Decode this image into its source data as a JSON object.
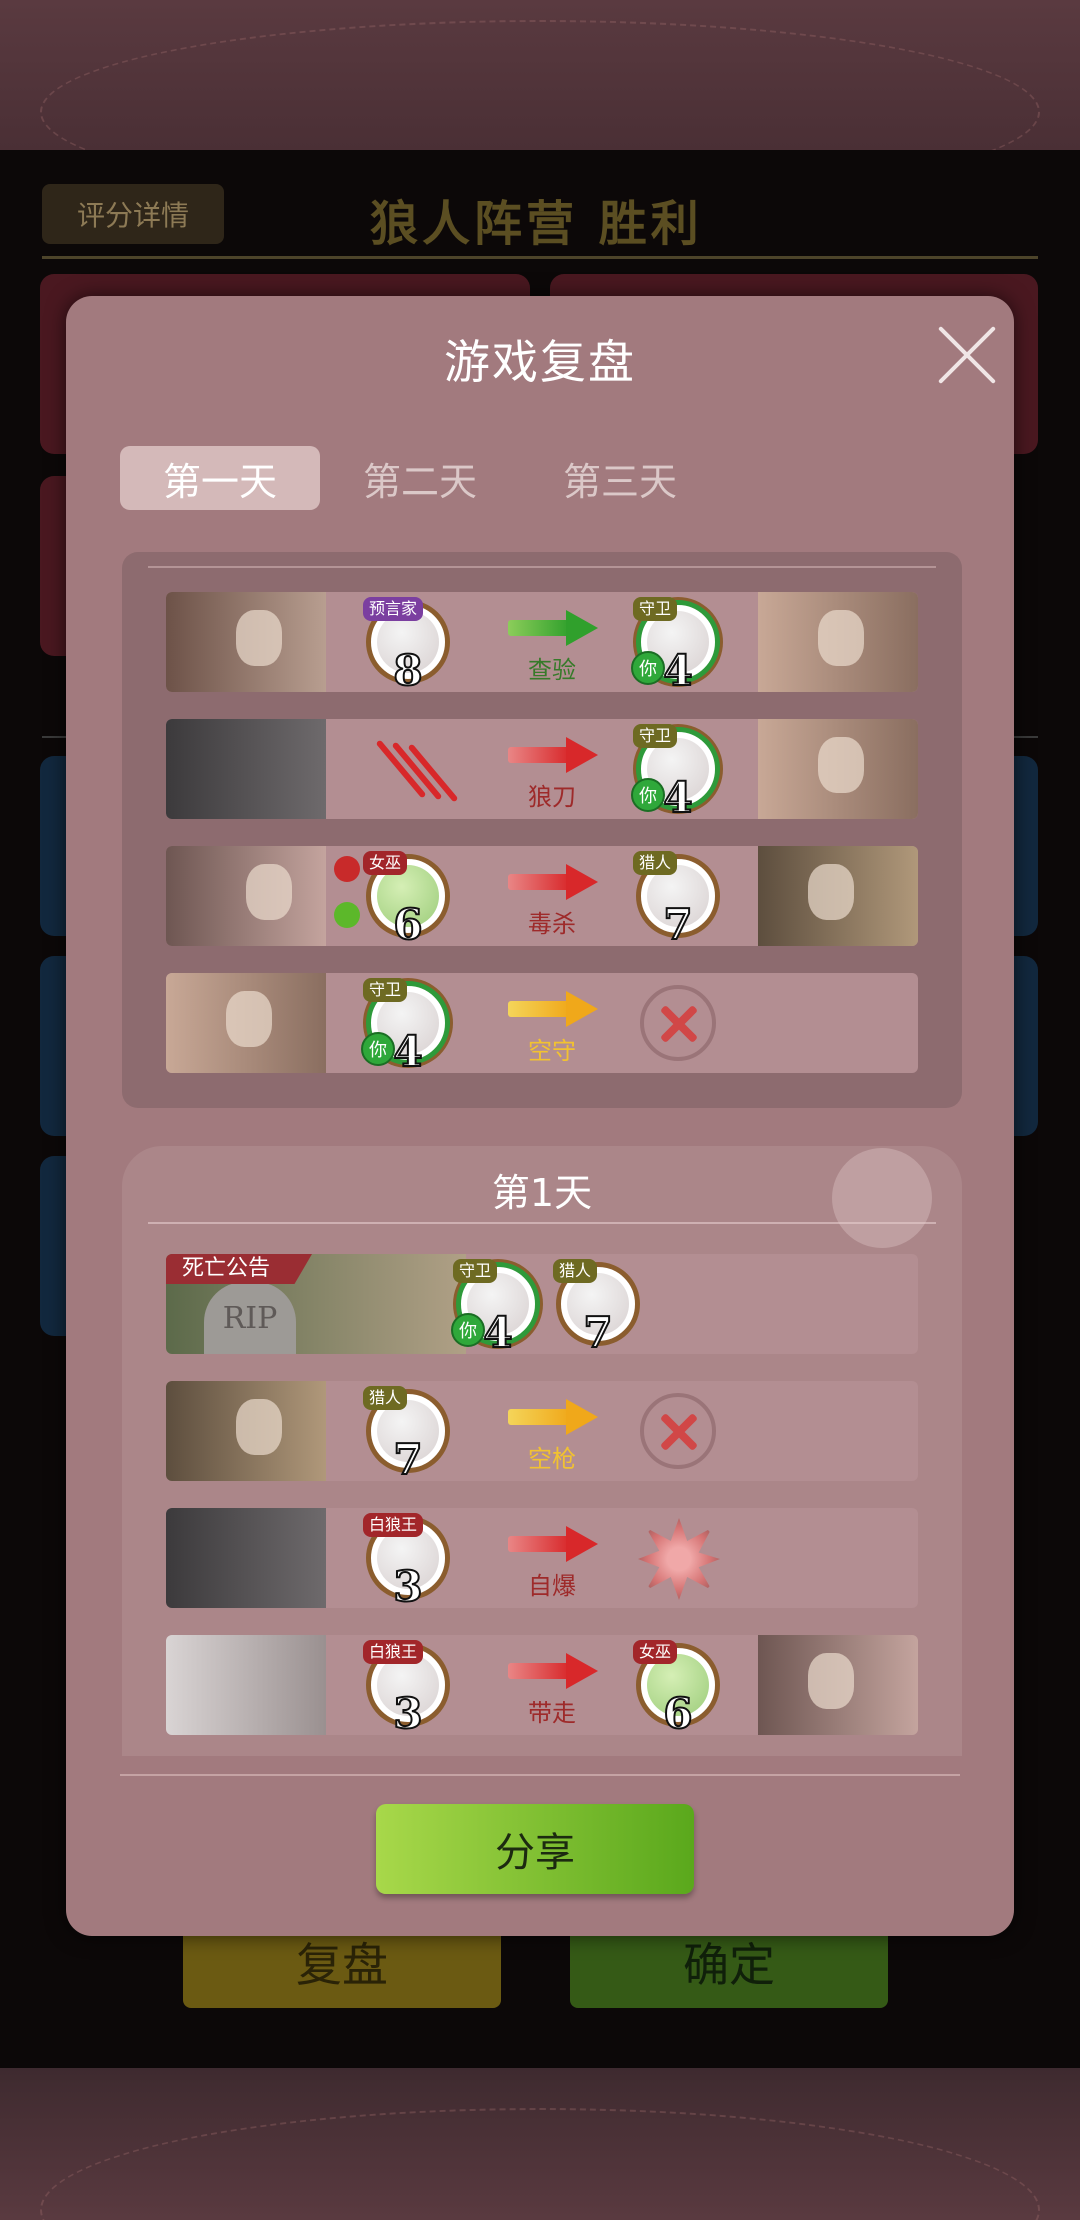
{
  "background": {
    "score_button": "评分详情",
    "result_title": "狼人阵营  胜利",
    "replay_button": "复盘",
    "confirm_button": "确定"
  },
  "modal": {
    "title": "游戏复盘",
    "tabs": [
      {
        "label": "第一天",
        "active": true
      },
      {
        "label": "第二天",
        "active": false
      },
      {
        "label": "第三天",
        "active": false
      }
    ],
    "night_actions": [
      {
        "actor_role": "预言家",
        "actor_number": "8",
        "action": "查验",
        "arrow_color": "green",
        "target_role": "守卫",
        "target_number": "4",
        "target_is_you": true,
        "you_label": "你"
      },
      {
        "actor_role": "狼人",
        "action": "狼刀",
        "arrow_color": "red",
        "target_role": "守卫",
        "target_number": "4",
        "target_is_you": true,
        "you_label": "你"
      },
      {
        "actor_role": "女巫",
        "actor_number": "6",
        "action": "毒杀",
        "arrow_color": "red",
        "target_role": "猎人",
        "target_number": "7"
      },
      {
        "actor_role": "守卫",
        "actor_number": "4",
        "actor_is_you": true,
        "you_label": "你",
        "action": "空守",
        "arrow_color": "yellow",
        "target": "none"
      }
    ],
    "day": {
      "title": "第1天",
      "death_notice": "死亡公告",
      "tomb_text": "RIP",
      "deaths": [
        {
          "role": "守卫",
          "number": "4",
          "is_you": true,
          "you_label": "你"
        },
        {
          "role": "猎人",
          "number": "7"
        }
      ],
      "actions": [
        {
          "actor_role": "猎人",
          "actor_number": "7",
          "action": "空枪",
          "arrow_color": "yellow",
          "target": "none"
        },
        {
          "actor_role": "白狼王",
          "actor_number": "3",
          "action": "自爆",
          "arrow_color": "red",
          "target": "explosion"
        },
        {
          "actor_role": "白狼王",
          "actor_number": "3",
          "action": "带走",
          "arrow_color": "red",
          "target_role": "女巫",
          "target_number": "6"
        }
      ]
    },
    "share_button": "分享"
  },
  "colors": {
    "modal_bg": "#a27a7e",
    "arrow_green": "#30a02c",
    "arrow_red": "#d8282a",
    "arrow_yellow": "#f0a81a",
    "share_button": "#7cc12e"
  }
}
